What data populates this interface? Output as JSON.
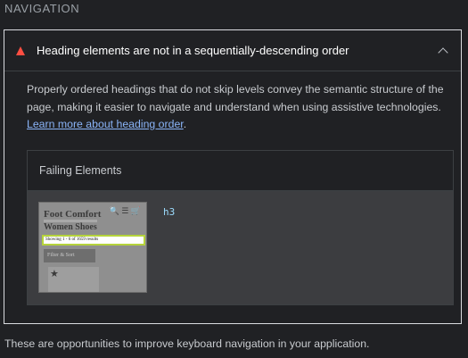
{
  "section": {
    "title": "NAVIGATION"
  },
  "audit": {
    "title": "Heading elements are not in a sequentially-descending order",
    "description": "Properly ordered headings that do not skip levels convey the semantic structure of the page, making it easier to navigate and understand when using assistive technologies. ",
    "link_text": "Learn more about heading order",
    "link_suffix": ".",
    "status_color": "#ff4e42"
  },
  "failing": {
    "header": "Failing Elements",
    "items": [
      {
        "thumbnail": {
          "brand": "Foot Comfort",
          "heading": "Women Shoes",
          "highlight_text": "Showing 1 - 6 of 1659 results",
          "button_text": "Filter & Sort",
          "icons": "🔍 ☰ 🛒"
        },
        "code": "h3"
      }
    ]
  },
  "footer": {
    "text": "These are opportunities to improve keyboard navigation in your application."
  }
}
